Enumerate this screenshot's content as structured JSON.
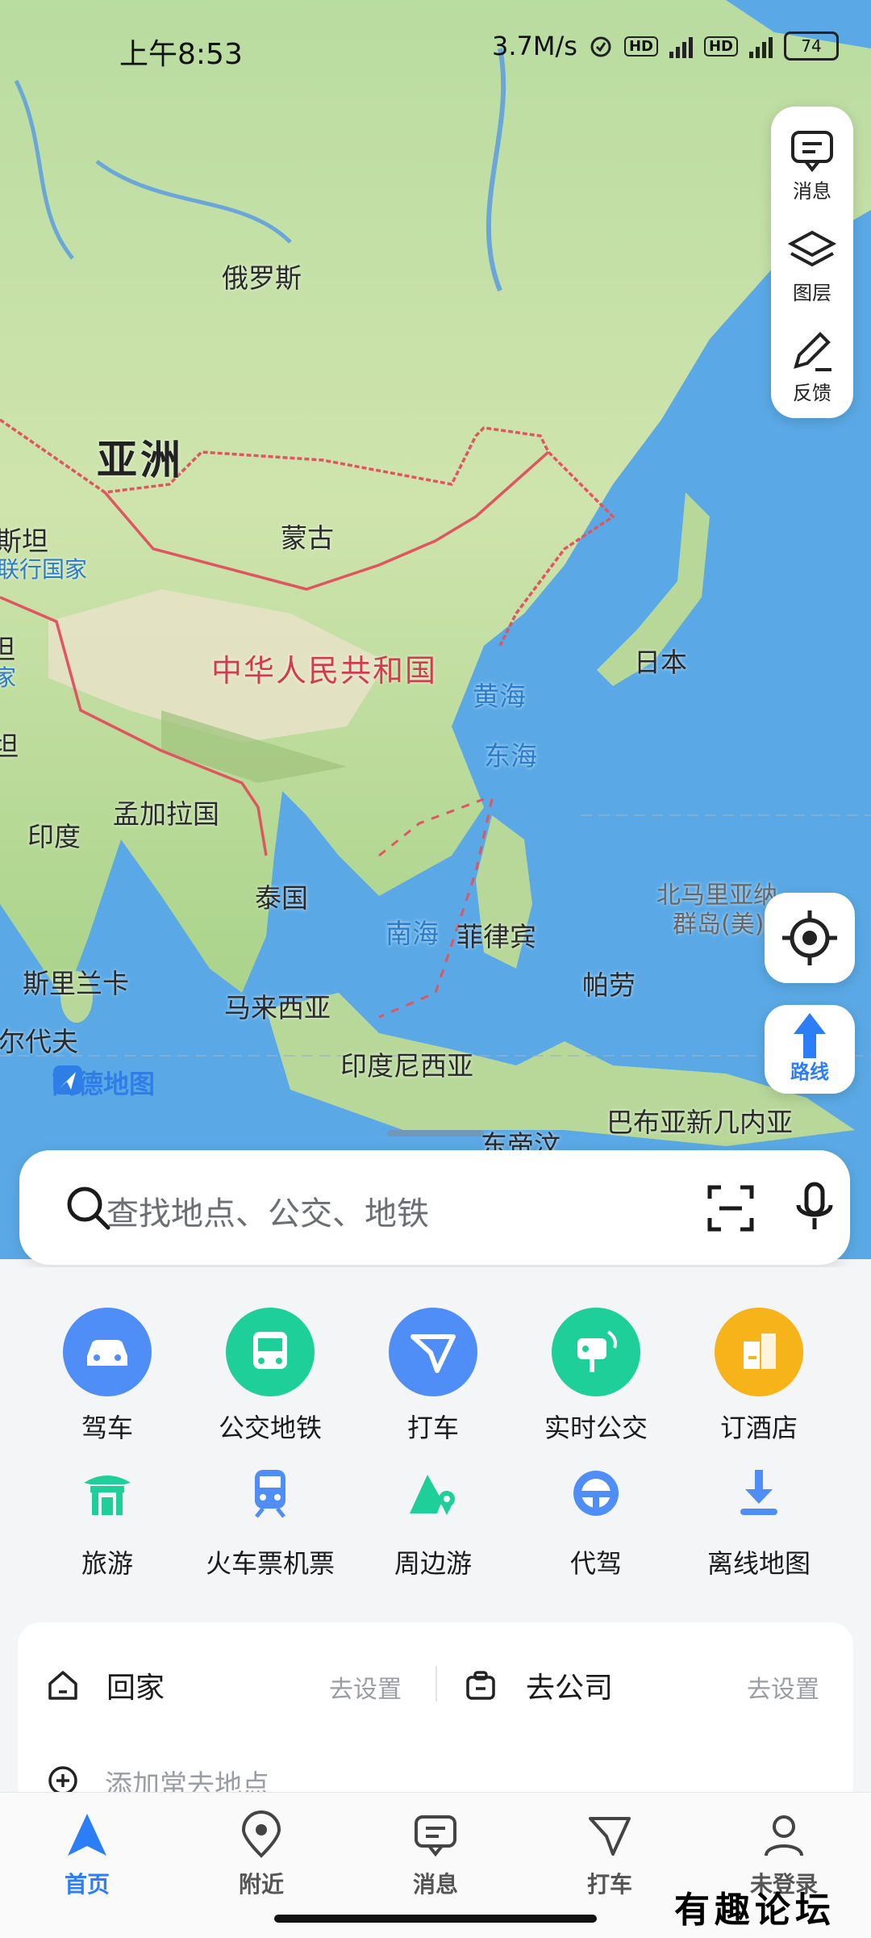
{
  "status_bar": {
    "time": "上午8:53",
    "speed": "3.7M/s",
    "hd1": "HD",
    "hd2": "HD",
    "battery": "74"
  },
  "map_tools": {
    "messages": "消息",
    "layers": "图层",
    "feedback": "反馈"
  },
  "route_button": {
    "label": "路线"
  },
  "map_labels": {
    "russia": "俄罗斯",
    "asia": "亚洲",
    "mongolia": "蒙古",
    "china": "中华人民共和国",
    "yellow_sea": "黄海",
    "east_sea": "东海",
    "japan": "日本",
    "north_mariana": "北马里亚纳",
    "north_mariana2": "群岛(美)",
    "south_sea": "南海",
    "philippines": "菲律宾",
    "palau": "帕劳",
    "india": "印度",
    "bangladesh": "孟加拉国",
    "thailand": "泰国",
    "sri_lanka": "斯里兰卡",
    "malaysia": "马来西亚",
    "maldives": "尔代夫",
    "indonesia": "印度尼西亚",
    "papua": "巴布亚新几内亚",
    "east_timor": "东帝汶",
    "stan": "斯坦",
    "stan_sub": "联行国家",
    "stan2": "坦",
    "stan2_sub": "家",
    "stan3": "坦"
  },
  "brand": "高德地图",
  "search": {
    "placeholder": "查找地点、公交、地铁"
  },
  "services_row1": [
    {
      "label": "驾车",
      "icon": "car-icon",
      "color": "#4f8ef7"
    },
    {
      "label": "公交地铁",
      "icon": "bus-icon",
      "color": "#1fcf9a"
    },
    {
      "label": "打车",
      "icon": "taxi-icon",
      "color": "#4f8ef7"
    },
    {
      "label": "实时公交",
      "icon": "realtime-bus-icon",
      "color": "#1fcf9a"
    },
    {
      "label": "订酒店",
      "icon": "hotel-icon",
      "color": "#f6b31a"
    }
  ],
  "services_row2": [
    {
      "label": "旅游",
      "icon": "pavilion-icon"
    },
    {
      "label": "火车票机票",
      "icon": "train-icon"
    },
    {
      "label": "周边游",
      "icon": "mountain-pin-icon"
    },
    {
      "label": "代驾",
      "icon": "steering-wheel-icon"
    },
    {
      "label": "离线地图",
      "icon": "download-icon"
    }
  ],
  "favorites": {
    "home": "回家",
    "home_set": "去设置",
    "company": "去公司",
    "company_set": "去设置",
    "add": "添加常去地点"
  },
  "tabs": [
    {
      "label": "首页"
    },
    {
      "label": "附近"
    },
    {
      "label": "消息"
    },
    {
      "label": "打车"
    },
    {
      "label": "未登录"
    }
  ],
  "watermark": "有趣论坛",
  "colors": {
    "accent": "#2c7ef8",
    "green": "#1fcf9a",
    "sea": "#5aa9e6",
    "land": "#c9e3a8"
  }
}
